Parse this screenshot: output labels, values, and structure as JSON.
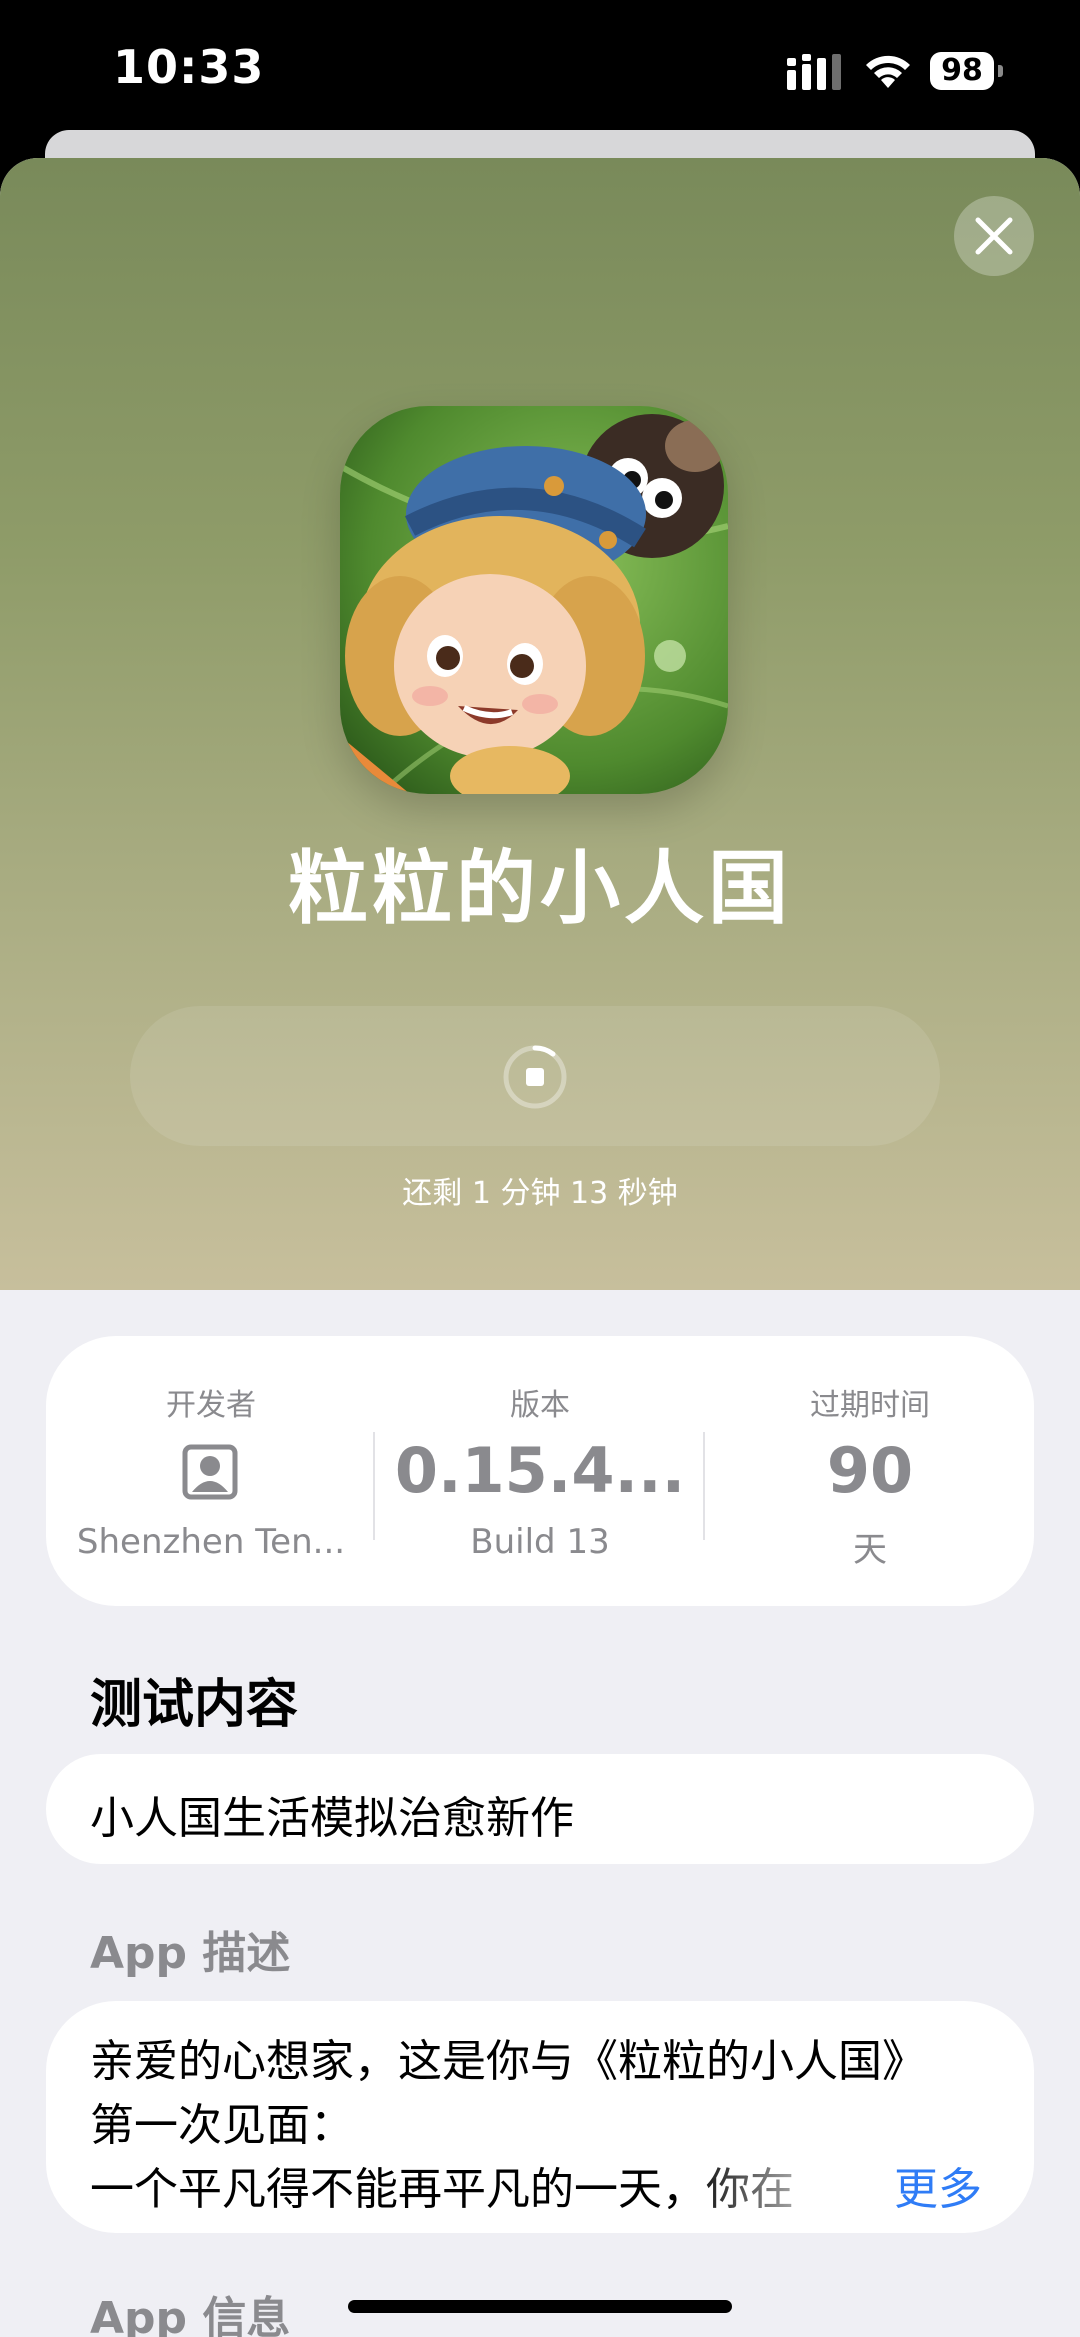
{
  "status_bar": {
    "time": "10:33",
    "battery": "98"
  },
  "app": {
    "name": "粒粒的小人国",
    "time_remaining": "还剩 1 分钟 13 秒钟",
    "download_progress": 0.12
  },
  "info": {
    "developer": {
      "label": "开发者",
      "value": "Shenzhen Ten..."
    },
    "version": {
      "label": "版本",
      "value": "0.15.4...",
      "build": "Build 13"
    },
    "expiry": {
      "label": "过期时间",
      "value": "90",
      "unit": "天"
    }
  },
  "test_content": {
    "title": "测试内容",
    "text": "小人国生活模拟治愈新作"
  },
  "description": {
    "title": "App 描述",
    "lines": [
      "亲爱的心想家，这是你与《粒粒的小人国》",
      "第一次见面：",
      "一个平凡得不能再平凡的一天，你在"
    ],
    "more": "更多"
  },
  "app_info": {
    "title": "App 信息"
  },
  "colors": {
    "hero_top": "#798a5a",
    "hero_bottom": "#c7bf9c",
    "link": "#2f7cf6",
    "sheet_bg": "#efeff4"
  }
}
